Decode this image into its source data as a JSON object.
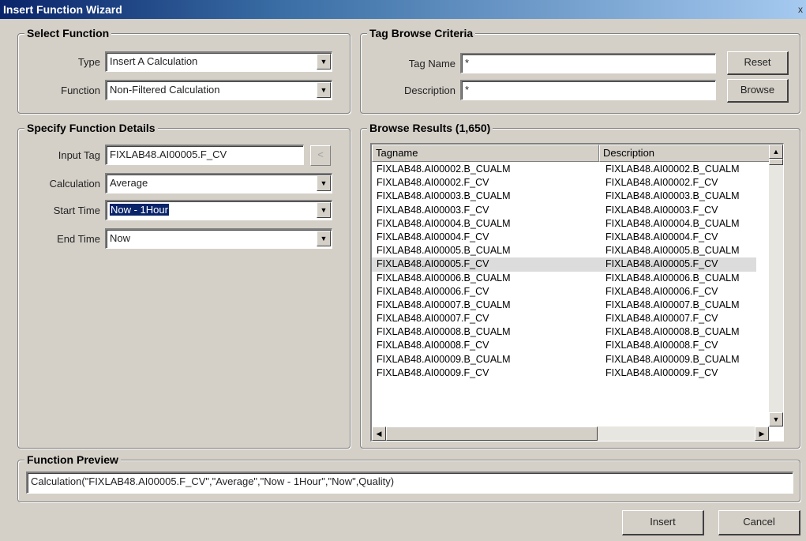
{
  "window": {
    "title": "Insert Function Wizard",
    "close_label": "x"
  },
  "select_function": {
    "title": "Select Function",
    "type_label": "Type",
    "type_value": "Insert A Calculation",
    "function_label": "Function",
    "function_value": "Non-Filtered Calculation"
  },
  "tag_browse": {
    "title": "Tag Browse Criteria",
    "tag_name_label": "Tag Name",
    "tag_name_value": "*",
    "description_label": "Description",
    "description_value": "*",
    "reset_label": "Reset",
    "browse_label": "Browse"
  },
  "function_details": {
    "title": "Specify Function Details",
    "input_tag_label": "Input Tag",
    "input_tag_value": "FIXLAB48.AI00005.F_CV",
    "pick_button": "<",
    "calculation_label": "Calculation",
    "calculation_value": "Average",
    "start_time_label": "Start Time",
    "start_time_value": "Now - 1Hour",
    "end_time_label": "End Time",
    "end_time_value": "Now"
  },
  "browse_results": {
    "title": "Browse Results (1,650)",
    "columns": [
      "Tagname",
      "Description"
    ],
    "rows": [
      [
        "FIXLAB48.AI00002.B_CUALM",
        "FIXLAB48.AI00002.B_CUALM"
      ],
      [
        "FIXLAB48.AI00002.F_CV",
        "FIXLAB48.AI00002.F_CV"
      ],
      [
        "FIXLAB48.AI00003.B_CUALM",
        "FIXLAB48.AI00003.B_CUALM"
      ],
      [
        "FIXLAB48.AI00003.F_CV",
        "FIXLAB48.AI00003.F_CV"
      ],
      [
        "FIXLAB48.AI00004.B_CUALM",
        "FIXLAB48.AI00004.B_CUALM"
      ],
      [
        "FIXLAB48.AI00004.F_CV",
        "FIXLAB48.AI00004.F_CV"
      ],
      [
        "FIXLAB48.AI00005.B_CUALM",
        "FIXLAB48.AI00005.B_CUALM"
      ],
      [
        "FIXLAB48.AI00005.F_CV",
        "FIXLAB48.AI00005.F_CV"
      ],
      [
        "FIXLAB48.AI00006.B_CUALM",
        "FIXLAB48.AI00006.B_CUALM"
      ],
      [
        "FIXLAB48.AI00006.F_CV",
        "FIXLAB48.AI00006.F_CV"
      ],
      [
        "FIXLAB48.AI00007.B_CUALM",
        "FIXLAB48.AI00007.B_CUALM"
      ],
      [
        "FIXLAB48.AI00007.F_CV",
        "FIXLAB48.AI00007.F_CV"
      ],
      [
        "FIXLAB48.AI00008.B_CUALM",
        "FIXLAB48.AI00008.B_CUALM"
      ],
      [
        "FIXLAB48.AI00008.F_CV",
        "FIXLAB48.AI00008.F_CV"
      ],
      [
        "FIXLAB48.AI00009.B_CUALM",
        "FIXLAB48.AI00009.B_CUALM"
      ],
      [
        "FIXLAB48.AI00009.F_CV",
        "FIXLAB48.AI00009.F_CV"
      ]
    ],
    "selected_index": 7
  },
  "function_preview": {
    "title": "Function Preview",
    "value": "Calculation(\"FIXLAB48.AI00005.F_CV\",\"Average\",\"Now - 1Hour\",\"Now\",Quality)"
  },
  "actions": {
    "insert_label": "Insert",
    "cancel_label": "Cancel"
  },
  "icons": {
    "dropdown": "chevron-down-icon",
    "scroll_up": "arrow-up-icon",
    "scroll_down": "arrow-down-icon",
    "scroll_left": "arrow-left-icon",
    "scroll_right": "arrow-right-icon"
  },
  "colors": {
    "title_bar": "#0a246a",
    "selection": "#0a246a",
    "dialog": "#d4d0c8"
  }
}
